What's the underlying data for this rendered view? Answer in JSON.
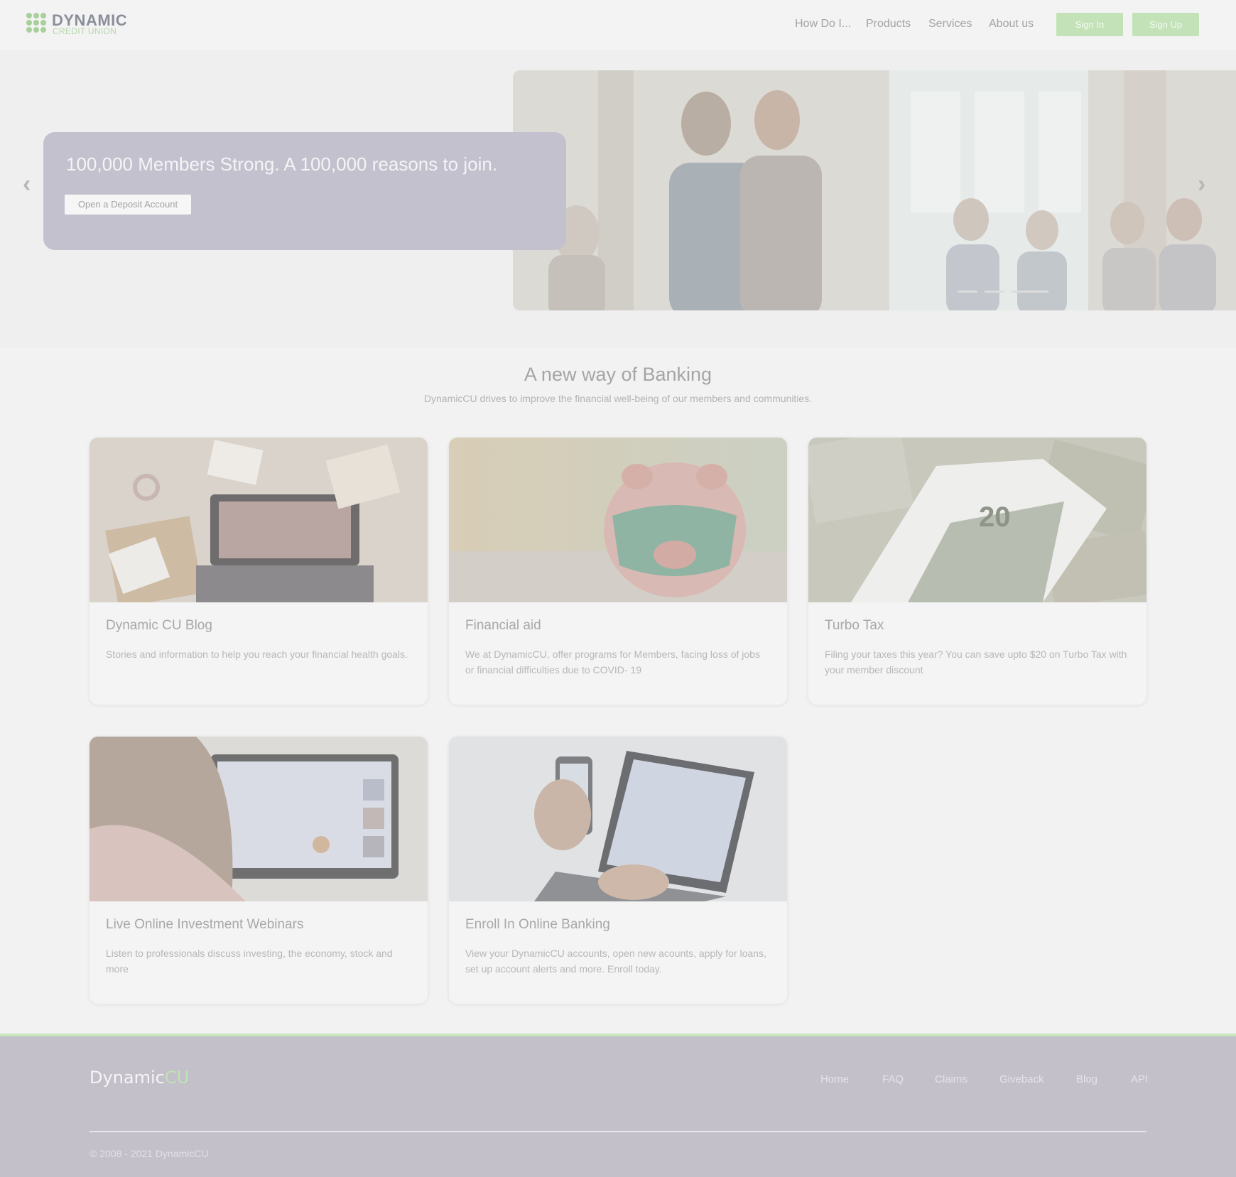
{
  "header": {
    "logo_title": "DYNAMIC",
    "logo_subtitle": "CREDIT UNION",
    "nav": [
      "How Do I...",
      "Products",
      "Services",
      "About us"
    ],
    "sign_in": "Sign In",
    "sign_up": "Sign Up"
  },
  "hero": {
    "headline": "100,000 Members Strong. A 100,000 reasons to join.",
    "cta": "Open a Deposit Account",
    "prev_icon": "‹",
    "next_icon": "›"
  },
  "section": {
    "title": "A new way of Banking",
    "subtitle": "DynamicCU drives to improve the financial well-being of our members and communities."
  },
  "cards": [
    {
      "title": "Dynamic CU Blog",
      "text": "Stories and information to help you reach your financial health goals."
    },
    {
      "title": "Financial aid",
      "text": "We at DynamicCU, offer programs for Members, facing loss of jobs or financial difficulties due to COVID- 19"
    },
    {
      "title": "Turbo Tax",
      "text": "Filing your taxes this year? You can save upto $20 on Turbo Tax with your member discount"
    },
    {
      "title": "Live Online Investment Webinars",
      "text": "Listen to professionals discuss investing, the economy, stock and more"
    },
    {
      "title": "Enroll In Online Banking",
      "text": "View your DynamicCU accounts, open new acounts, apply for loans, set up account alerts and more. Enroll today."
    }
  ],
  "footer": {
    "brand_main": "Dynamic",
    "brand_accent": "CU",
    "links": [
      "Home",
      "FAQ",
      "Claims",
      "Giveback",
      "Blog",
      "API"
    ],
    "copyright": "© 2008 - 2021 DynamicCU"
  },
  "colors": {
    "accent_green": "#c3e2b8",
    "hero_box": "#c4c1cf",
    "footer_bg": "#c3c0ca"
  }
}
